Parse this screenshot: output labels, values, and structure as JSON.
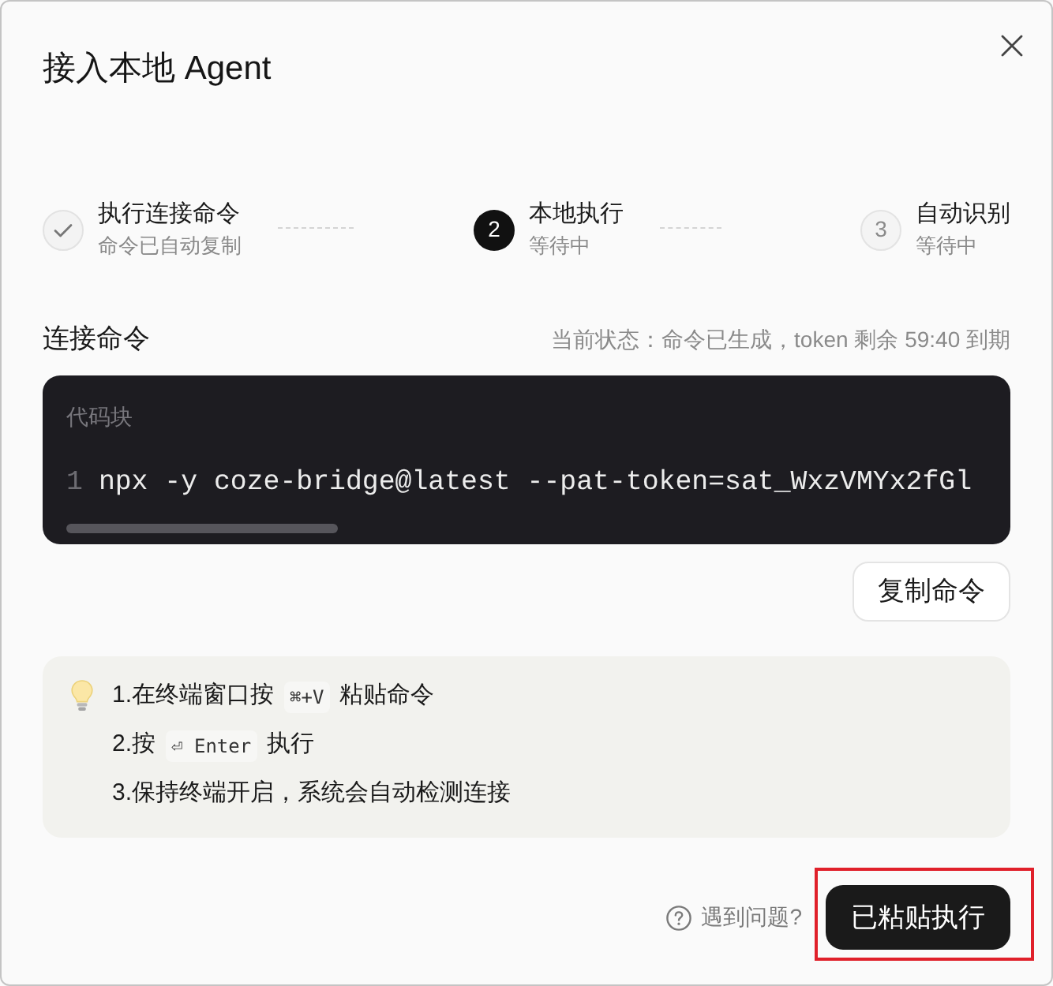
{
  "title": "接入本地 Agent",
  "steps": [
    {
      "completed": true,
      "current": false,
      "title": "执行连接命令",
      "subtitle": "命令已自动复制"
    },
    {
      "completed": false,
      "current": true,
      "number": "2",
      "title": "本地执行",
      "subtitle": "等待中"
    },
    {
      "completed": false,
      "current": false,
      "number": "3",
      "title": "自动识别",
      "subtitle": "等待中"
    }
  ],
  "command_section": {
    "heading": "连接命令",
    "status": "当前状态：命令已生成，token 剩余 59:40 到期",
    "code_block": {
      "label": "代码块",
      "lines": [
        {
          "number": "1",
          "code": "npx -y coze-bridge@latest --pat-token=sat_WxzVMYx2fGl"
        }
      ]
    },
    "copy_button": "复制命令"
  },
  "tips": [
    {
      "parts": [
        {
          "kind": "text",
          "text": "1.在终端窗口按"
        },
        {
          "kind": "key",
          "text": "⌘+V"
        },
        {
          "kind": "text",
          "text": "粘贴命令"
        }
      ]
    },
    {
      "parts": [
        {
          "kind": "text",
          "text": "2.按"
        },
        {
          "kind": "key",
          "text": "⏎ Enter"
        },
        {
          "kind": "text",
          "text": "执行"
        }
      ]
    },
    {
      "parts": [
        {
          "kind": "text",
          "text": "3.保持终端开启，系统会自动检测连接"
        }
      ]
    }
  ],
  "footer": {
    "help_link": "遇到问题?",
    "primary_button": {
      "label": "已粘贴执行",
      "highlighted": true
    }
  }
}
